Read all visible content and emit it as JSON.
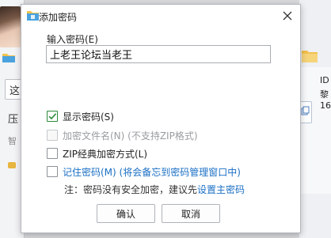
{
  "background": {
    "left_texts": [
      "这",
      "压",
      "智"
    ],
    "right_texts": [
      "ID",
      "黎",
      "16"
    ]
  },
  "dialog": {
    "title": "添加密码",
    "password_label": "输入密码(E)",
    "password_value": "上老王论坛当老王",
    "options": {
      "show_password": {
        "label": "显示密码(S)",
        "checked": true
      },
      "encrypt_filenames": {
        "label": "加密文件名(N) (不支持ZIP格式)",
        "checked": false,
        "disabled": true
      },
      "zip_classic": {
        "label": "ZIP经典加密方式(L)",
        "checked": false
      },
      "remember_password": {
        "label": "记住密码(M) (将会备忘到密码管理窗口中)",
        "checked": false
      }
    },
    "note_prefix": "注：密码没有安全加密，建议先",
    "note_link": "设置主密码",
    "ok_label": "确认",
    "cancel_label": "取消"
  },
  "colors": {
    "accent_link": "#1a6fc4",
    "check_green": "#2a8a3a"
  }
}
